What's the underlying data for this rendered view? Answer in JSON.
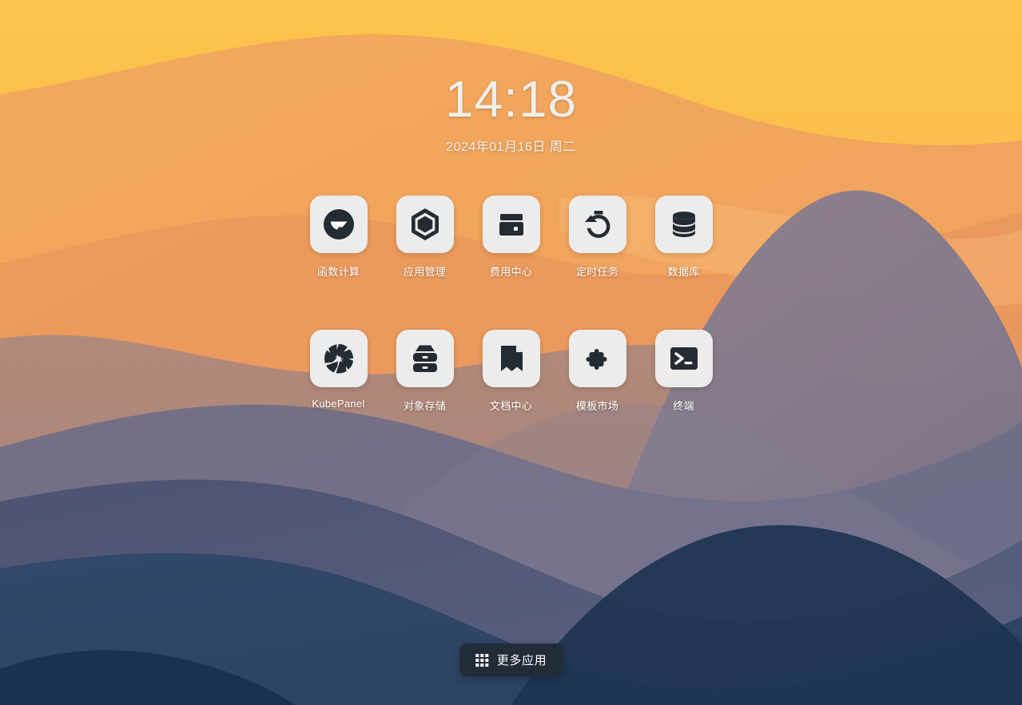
{
  "clock": {
    "time": "14:18",
    "date": "2024年01月16日 周二"
  },
  "apps": {
    "row1": [
      {
        "label": "函数计算",
        "icon": "function-compute-icon"
      },
      {
        "label": "应用管理",
        "icon": "app-management-cube-icon"
      },
      {
        "label": "费用中心",
        "icon": "wallet-icon"
      },
      {
        "label": "定时任务",
        "icon": "stopwatch-icon"
      },
      {
        "label": "数据库",
        "icon": "database-icon"
      }
    ],
    "row2": [
      {
        "label": "KubePanel",
        "icon": "aperture-icon"
      },
      {
        "label": "对象存储",
        "icon": "object-storage-icon"
      },
      {
        "label": "文档中心",
        "icon": "bookmark-document-icon"
      },
      {
        "label": "模板市场",
        "icon": "puzzle-piece-icon"
      },
      {
        "label": "终端",
        "icon": "terminal-icon"
      }
    ]
  },
  "more_apps": {
    "label": "更多应用",
    "icon": "grid-3x3-icon"
  },
  "colors": {
    "sky_top": "#FCBE4B",
    "sky_mid": "#F2A95D",
    "ridge_mauve": "#AE8678",
    "ridge_purple": "#7E7488",
    "ridge_slate": "#4C5270",
    "ridge_navy": "#2E4464",
    "ridge_deep": "#1E3550",
    "tile_bg": "#ECECEC",
    "icon_fg": "#242B33",
    "button_bg": "#222B38",
    "text_light": "#FFFFFF"
  }
}
